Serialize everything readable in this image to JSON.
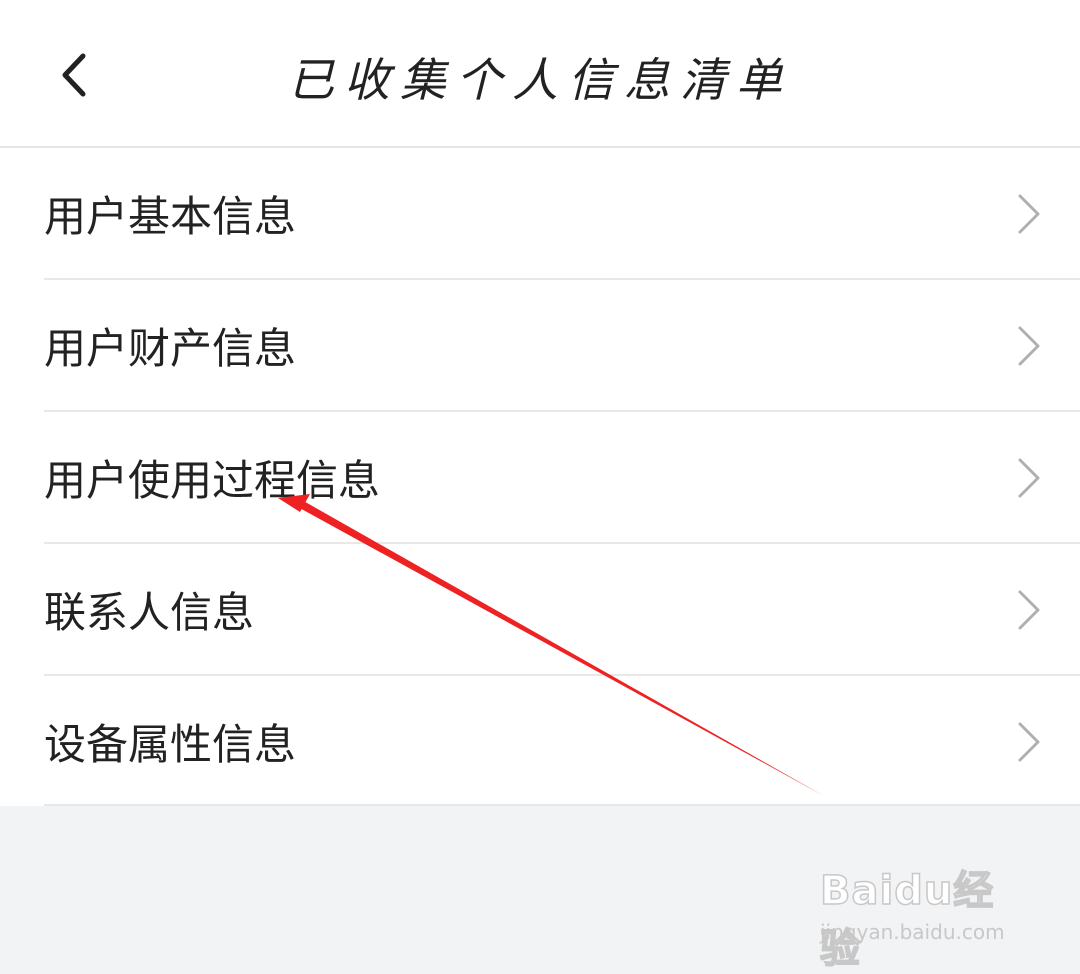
{
  "header": {
    "title": "已收集个人信息清单"
  },
  "list": {
    "items": [
      {
        "label": "用户基本信息"
      },
      {
        "label": "用户财产信息"
      },
      {
        "label": "用户使用过程信息"
      },
      {
        "label": "联系人信息"
      },
      {
        "label": "设备属性信息"
      }
    ]
  },
  "watermark": {
    "logo": "Baidu经验",
    "url": "jingyan.baidu.com"
  },
  "colors": {
    "background": "#f2f3f5",
    "list_bg": "#ffffff",
    "annotation_arrow": "#ee2222"
  },
  "icons": {
    "back": "chevron-left-icon",
    "row_chevron": "chevron-right-icon"
  }
}
